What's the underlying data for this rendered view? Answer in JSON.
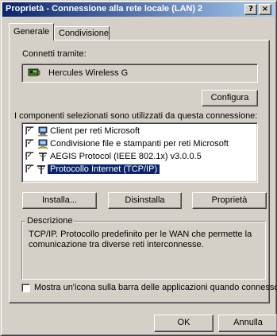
{
  "window": {
    "title": "Proprietà - Connessione alla rete locale (LAN) 2",
    "help_glyph": "?",
    "close_glyph": "×"
  },
  "tabs": [
    {
      "label": "Generale",
      "active": true
    },
    {
      "label": "Condivisione",
      "active": false
    }
  ],
  "general": {
    "connect_label": "Connetti tramite:",
    "adapter_name": "Hercules Wireless G",
    "adapter_icon": "network-card-icon",
    "configure_label": "Configura",
    "components_label": "I componenti selezionati sono utilizzati da questa connessione:",
    "components": [
      {
        "label": "Client per reti Microsoft",
        "checked": true,
        "selected": false,
        "icon": "network-client-icon"
      },
      {
        "label": "Condivisione file e stampanti per reti Microsoft",
        "checked": true,
        "selected": false,
        "icon": "file-sharing-icon"
      },
      {
        "label": "AEGIS Protocol (IEEE 802.1x) v3.0.0.5",
        "checked": true,
        "selected": false,
        "icon": "protocol-icon"
      },
      {
        "label": "Protocollo Internet (TCP/IP)",
        "checked": true,
        "selected": true,
        "icon": "protocol-icon"
      }
    ],
    "install_label": "Installa...",
    "uninstall_label": "Disinstalla",
    "properties_label": "Proprietà",
    "description_legend": "Descrizione",
    "description_text": "TCP/IP. Protocollo predefinito per le WAN che permette la comunicazione tra diverse reti interconnesse.",
    "notify_label": "Mostra un'icona sulla barra delle applicazioni quando connesso",
    "notify_checked": false
  },
  "buttons": {
    "ok_label": "OK",
    "cancel_label": "Annulla"
  },
  "colors": {
    "title_start": "#0a246a",
    "title_end": "#a6caf0",
    "face": "#d4d0c8",
    "selection": "#0a246a"
  }
}
